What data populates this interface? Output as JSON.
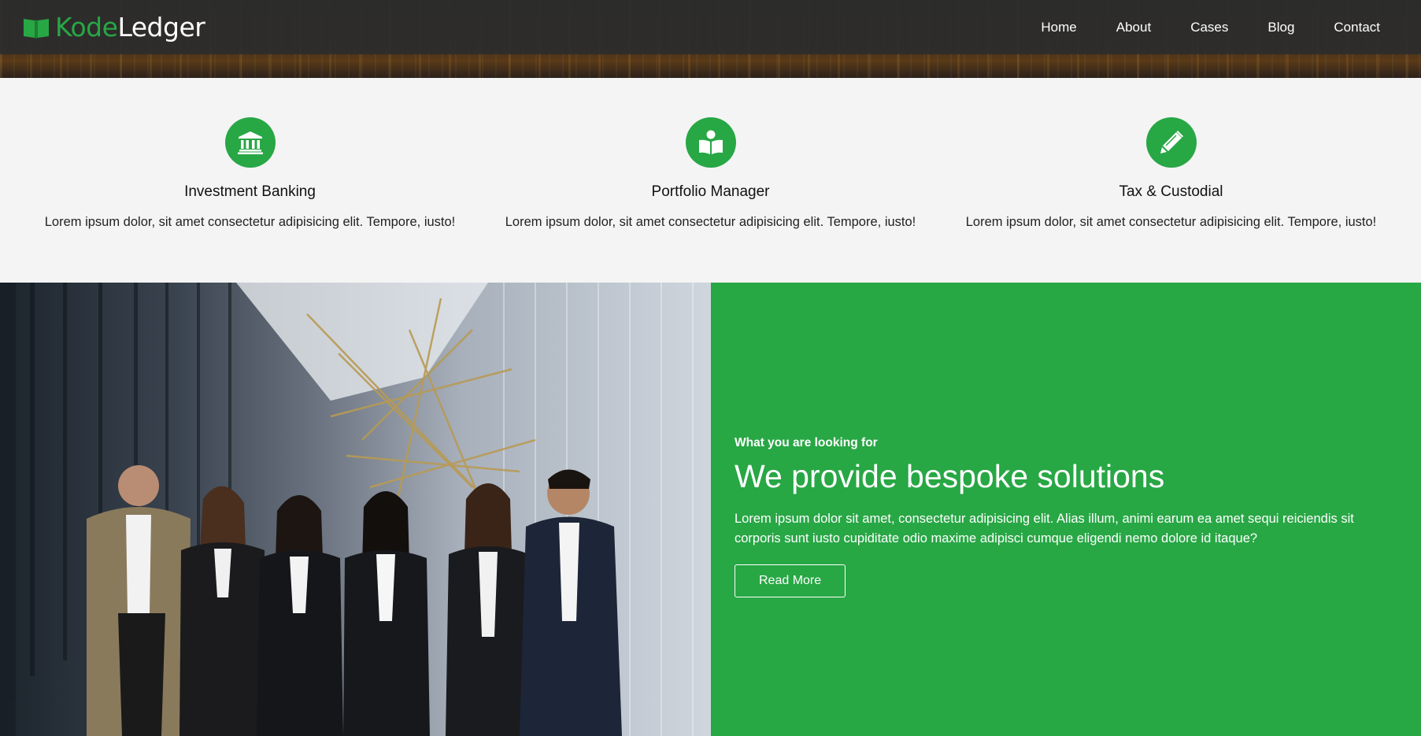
{
  "header": {
    "brand_part1": "Kode",
    "brand_part2": "Ledger",
    "nav": [
      "Home",
      "About",
      "Cases",
      "Blog",
      "Contact"
    ]
  },
  "features": [
    {
      "icon": "bank-icon",
      "title": "Investment Banking",
      "text": "Lorem ipsum dolor, sit amet consectetur adipisicing elit. Tempore, iusto!"
    },
    {
      "icon": "reader-icon",
      "title": "Portfolio Manager",
      "text": "Lorem ipsum dolor, sit amet consectetur adipisicing elit. Tempore, iusto!"
    },
    {
      "icon": "pencil-icon",
      "title": "Tax & Custodial",
      "text": "Lorem ipsum dolor, sit amet consectetur adipisicing elit. Tempore, iusto!"
    }
  ],
  "cta": {
    "eyebrow": "What you are looking for",
    "headline": "We provide bespoke solutions",
    "body": "Lorem ipsum dolor sit amet, consectetur adipisicing elit. Alias illum, animi earum ea amet sequi reiciendis sit corporis sunt iusto cupiditate odio maxime adipisci cumque eligendi nemo dolore id itaque?",
    "button_label": "Read More"
  },
  "colors": {
    "accent": "#28a745",
    "navbar": "#2d2d2d",
    "features_bg": "#f4f4f4"
  }
}
